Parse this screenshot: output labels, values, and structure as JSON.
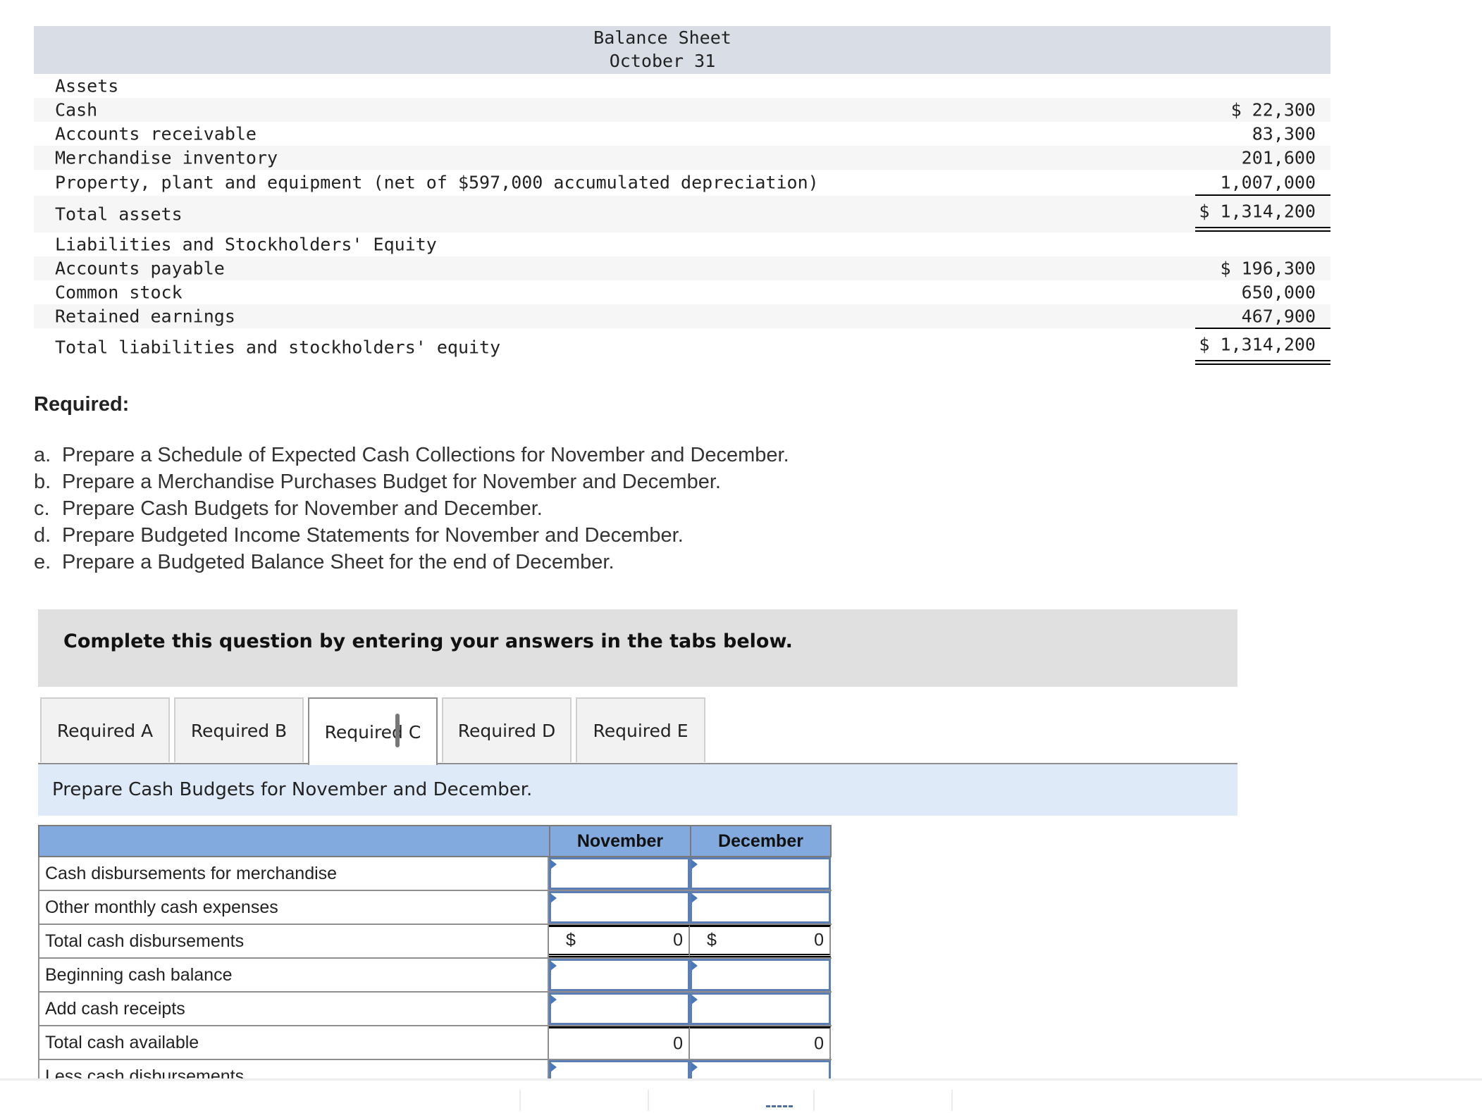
{
  "balance_sheet": {
    "title": "Balance Sheet",
    "date": "October 31",
    "rows": [
      {
        "label": "Assets",
        "value": ""
      },
      {
        "label": "Cash",
        "value": "$ 22,300"
      },
      {
        "label": "Accounts receivable",
        "value": "83,300"
      },
      {
        "label": "Merchandise inventory",
        "value": "201,600"
      },
      {
        "label": "Property, plant and equipment (net of $597,000 accumulated depreciation)",
        "value": "1,007,000"
      },
      {
        "label": "Total assets",
        "value": "$ 1,314,200"
      },
      {
        "label": "Liabilities and Stockholders' Equity",
        "value": ""
      },
      {
        "label": "Accounts payable",
        "value": "$ 196,300"
      },
      {
        "label": "Common stock",
        "value": "650,000"
      },
      {
        "label": "Retained earnings",
        "value": "467,900"
      },
      {
        "label": "Total liabilities and stockholders' equity",
        "value": "$ 1,314,200"
      }
    ]
  },
  "required": {
    "heading": "Required:",
    "items": [
      {
        "letter": "a.",
        "text": "Prepare a Schedule of Expected Cash Collections for November and December."
      },
      {
        "letter": "b.",
        "text": "Prepare a Merchandise Purchases Budget for November and December."
      },
      {
        "letter": "c.",
        "text": "Prepare Cash Budgets for November and December."
      },
      {
        "letter": "d.",
        "text": "Prepare Budgeted Income Statements for November and December."
      },
      {
        "letter": "e.",
        "text": "Prepare a Budgeted Balance Sheet for the end of December."
      }
    ]
  },
  "instruction": "Complete this question by entering your answers in the tabs below.",
  "tabs": [
    {
      "label": "Required A",
      "active": false
    },
    {
      "label": "Required B",
      "active": false
    },
    {
      "label": "Required C",
      "active": true
    },
    {
      "label": "Required D",
      "active": false
    },
    {
      "label": "Required E",
      "active": false
    }
  ],
  "prompt": "Prepare Cash Budgets for November and December.",
  "cash_budget": {
    "columns": [
      "November",
      "December"
    ],
    "rows": [
      {
        "label": "Cash disbursements for merchandise",
        "november": "",
        "december": ""
      },
      {
        "label": "Other monthly cash expenses",
        "november": "",
        "december": ""
      },
      {
        "label": "Total cash disbursements",
        "currency": "$",
        "november": "0",
        "december": "0"
      },
      {
        "label": "Beginning cash balance",
        "november": "",
        "december": ""
      },
      {
        "label": "Add cash receipts",
        "november": "",
        "december": ""
      },
      {
        "label": "Total cash available",
        "november": "0",
        "december": "0"
      },
      {
        "label": "Less cash disbursements",
        "november": "",
        "december": ""
      }
    ]
  }
}
